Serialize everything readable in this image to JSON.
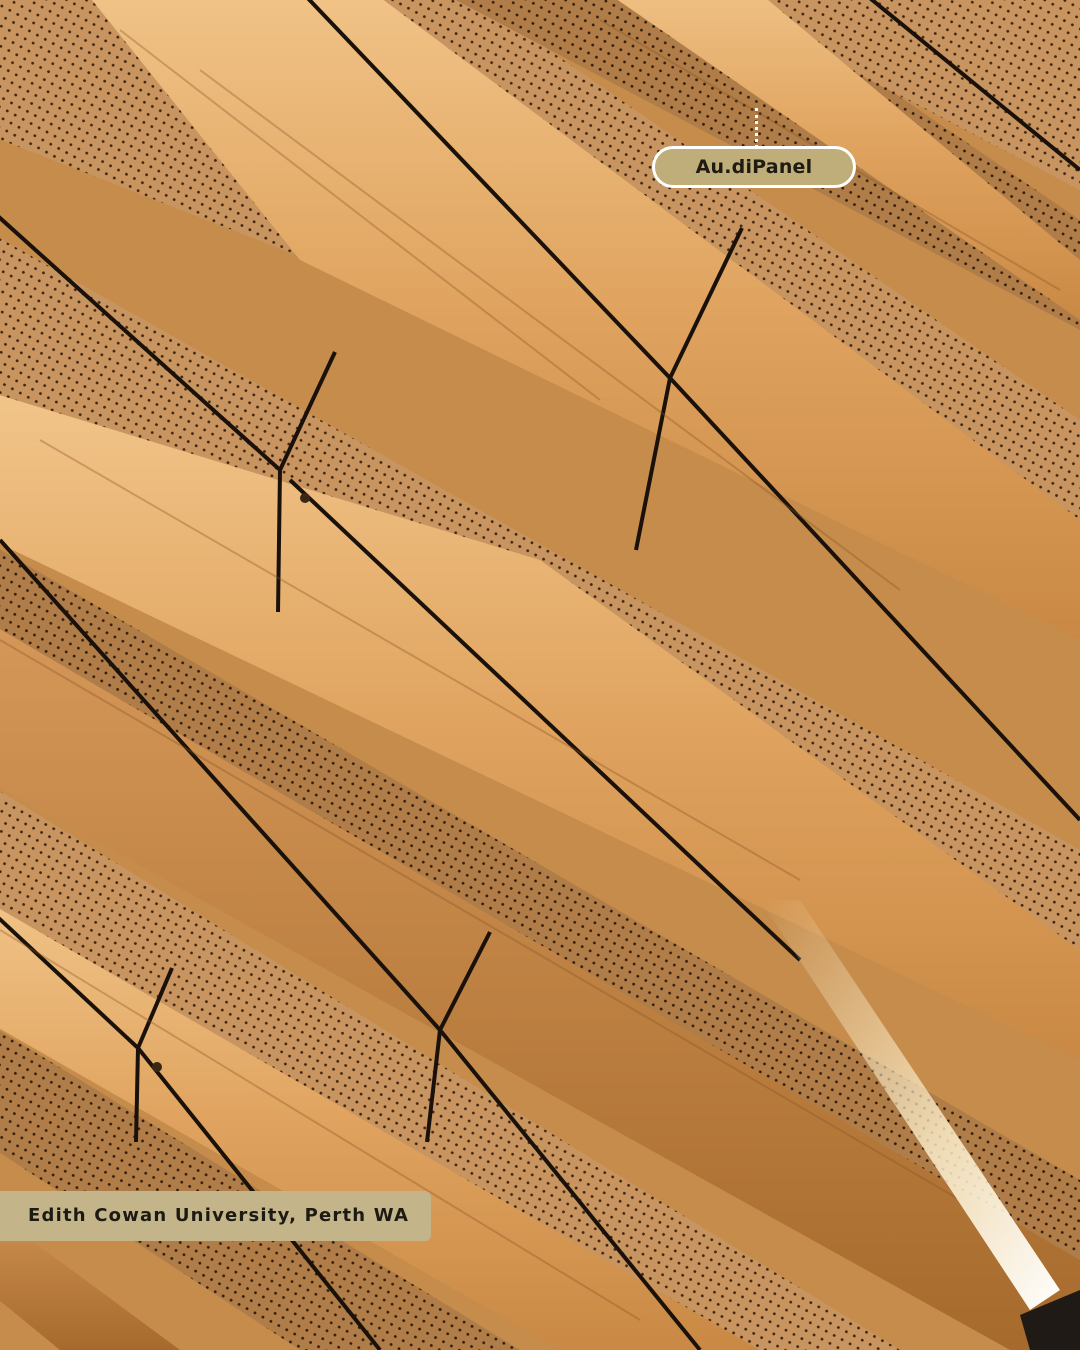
{
  "photo": {
    "subject": "perforated timber acoustic ceiling panels",
    "colors": {
      "light_timber": "#f0c48a",
      "mid_timber": "#d49a55",
      "dark_timber": "#a66a2c",
      "perforated_panel": "#c89560",
      "joint_line": "#1a120a",
      "light_strip": "#fff3d0"
    }
  },
  "tags": {
    "product_label": "Au.diPanel",
    "location_label": "Edith Cowan University, Perth WA",
    "product_bg": "#bfae7a",
    "location_bg": "#c4b48a"
  }
}
